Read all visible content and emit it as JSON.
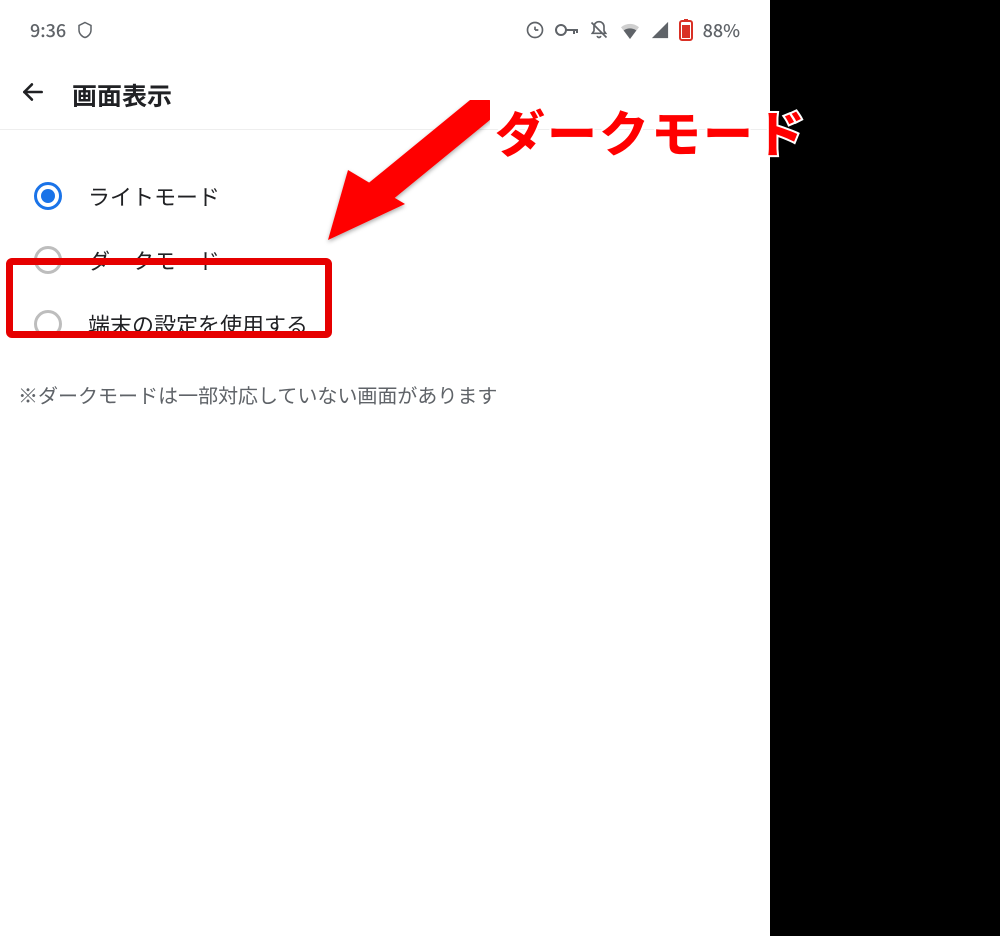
{
  "statusbar": {
    "time": "9:36",
    "battery_pct": "88%"
  },
  "header": {
    "title": "画面表示"
  },
  "options": [
    {
      "label": "ライトモード",
      "selected": true
    },
    {
      "label": "ダークモード",
      "selected": false
    },
    {
      "label": "端末の設定を使用する",
      "selected": false
    }
  ],
  "note": "※ダークモードは一部対応していない画面があります",
  "annotation": {
    "text": "ダークモード"
  },
  "colors": {
    "accent": "#1a73e8",
    "callout": "#e60000",
    "annotation": "#ff0000"
  }
}
